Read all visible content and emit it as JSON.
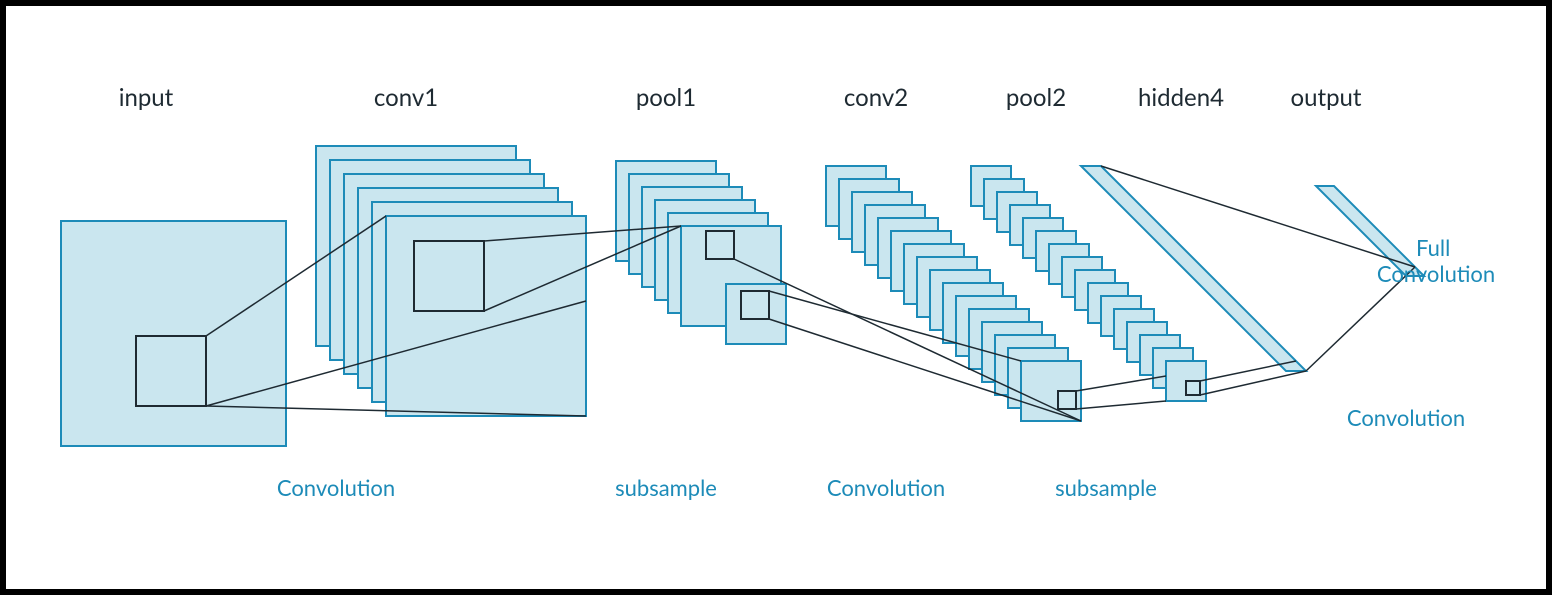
{
  "layers": {
    "input": "input",
    "conv1": "conv1",
    "pool1": "pool1",
    "conv2": "conv2",
    "pool2": "pool2",
    "hidden4": "hidden4",
    "output": "output"
  },
  "ops": {
    "conv_a": "Convolution",
    "sub_a": "subsample",
    "conv_b": "Convolution",
    "sub_b": "subsample",
    "full": "Full\nConvolution",
    "conv_out": "Convolution"
  }
}
